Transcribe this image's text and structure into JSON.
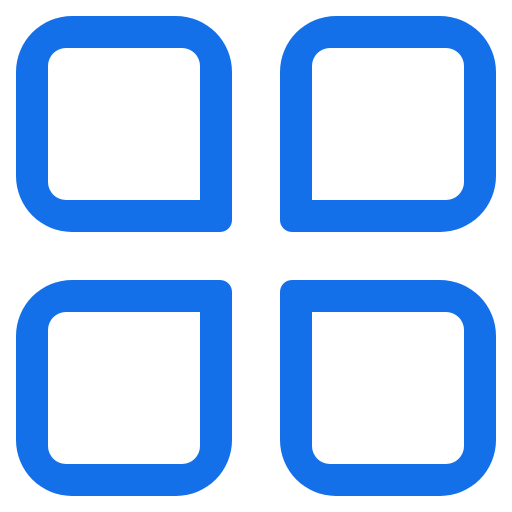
{
  "icon": {
    "name": "grid-view-icon",
    "color": "#1470E8",
    "background": "#FFFFFF"
  }
}
